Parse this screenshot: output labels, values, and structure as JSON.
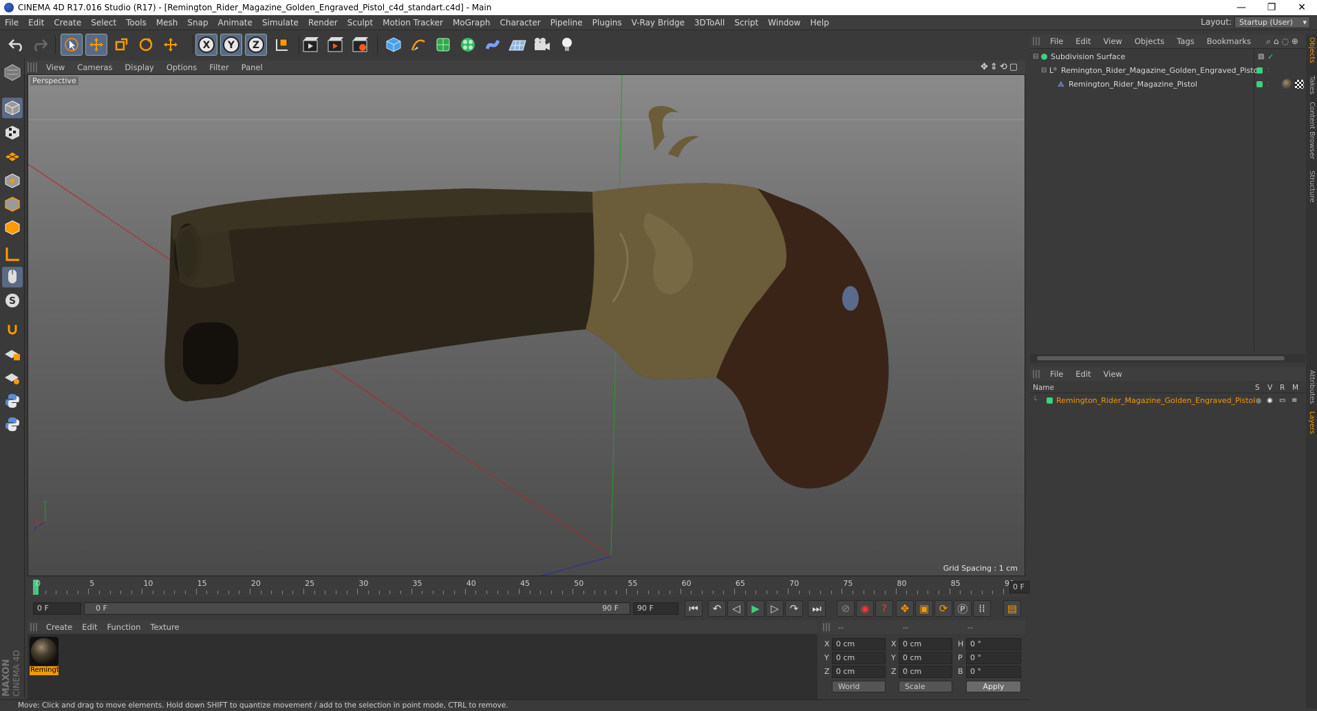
{
  "window": {
    "title": "CINEMA 4D R17.016 Studio (R17) - [Remington_Rider_Magazine_Golden_Engraved_Pistol_c4d_standart.c4d] - Main",
    "minimize": "—",
    "restore": "❐",
    "close": "✕"
  },
  "menubar": {
    "items": [
      "File",
      "Edit",
      "Create",
      "Select",
      "Tools",
      "Mesh",
      "Snap",
      "Animate",
      "Simulate",
      "Render",
      "Sculpt",
      "Motion Tracker",
      "MoGraph",
      "Character",
      "Pipeline",
      "Plugins",
      "V-Ray Bridge",
      "3DToAll",
      "Script",
      "Window",
      "Help"
    ],
    "layout_label": "Layout:",
    "layout_value": "Startup (User)"
  },
  "viewport": {
    "menu": [
      "View",
      "Cameras",
      "Display",
      "Options",
      "Filter",
      "Panel"
    ],
    "label": "Perspective",
    "grid_spacing": "Grid Spacing : 1 cm",
    "axis_y": "y",
    "axis_x": "x",
    "axis_z": "z"
  },
  "timeline": {
    "ticks": [
      "0",
      "5",
      "10",
      "15",
      "20",
      "25",
      "30",
      "35",
      "40",
      "45",
      "50",
      "55",
      "60",
      "65",
      "70",
      "75",
      "80",
      "85",
      "90"
    ],
    "current_frame": "0 F"
  },
  "transport": {
    "start": "0 F",
    "range_start": "0 F",
    "range_end": "90 F",
    "end": "90 F"
  },
  "material_manager": {
    "menu": [
      "Create",
      "Edit",
      "Function",
      "Texture"
    ],
    "material_name": "Remingt"
  },
  "coordinates": {
    "header": [
      "--",
      "--",
      "--"
    ],
    "rows": [
      {
        "a": "X",
        "av": "0 cm",
        "b": "X",
        "bv": "0 cm",
        "c": "H",
        "cv": "0 °"
      },
      {
        "a": "Y",
        "av": "0 cm",
        "b": "Y",
        "bv": "0 cm",
        "c": "P",
        "cv": "0 °"
      },
      {
        "a": "Z",
        "av": "0 cm",
        "b": "Z",
        "bv": "0 cm",
        "c": "B",
        "cv": "0 °"
      }
    ],
    "world": "World",
    "scale": "Scale",
    "apply": "Apply"
  },
  "status": "Move: Click and drag to move elements. Hold down SHIFT to quantize movement / add to the selection in point mode, CTRL to remove.",
  "object_manager": {
    "menu": [
      "File",
      "Edit",
      "View",
      "Objects",
      "Tags",
      "Bookmarks"
    ],
    "objects": [
      {
        "name": "Subdivision Surface",
        "color": "#3ad27a"
      },
      {
        "name": "Remington_Rider_Magazine_Golden_Engraved_Pistol",
        "color": "#3ad27a"
      },
      {
        "name": "Remington_Rider_Magazine_Pistol",
        "color": "#3ad27a"
      }
    ]
  },
  "layer_manager": {
    "menu": [
      "File",
      "Edit",
      "View"
    ],
    "col_name": "Name",
    "cols": [
      "S",
      "V",
      "R",
      "M"
    ],
    "layer_name": "Remington_Rider_Magazine_Golden_Engraved_Pistol",
    "layer_color": "#3ad27a"
  },
  "right_tabs": [
    "Objects",
    "Takes",
    "Content Browser",
    "Structure",
    "Attributes",
    "Layers"
  ],
  "logo": {
    "line1": "MAXON",
    "line2": "CINEMA 4D"
  },
  "colors": {
    "accent_orange": "#f09a0a",
    "selection_blue": "#5a6a85",
    "layer_green": "#3ad27a"
  }
}
